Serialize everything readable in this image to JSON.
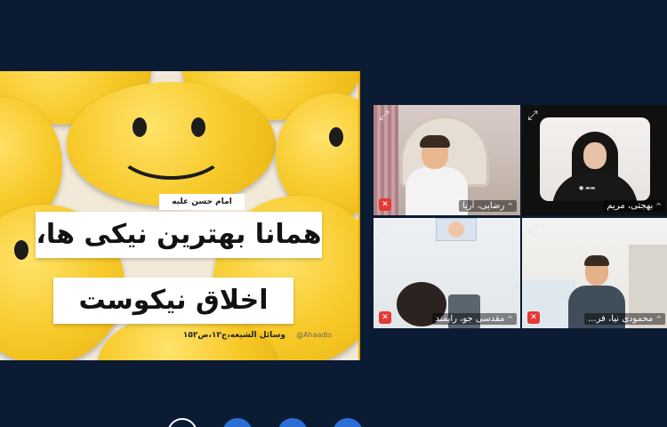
{
  "shared_content": {
    "attribution": "امام حسن علیه السلام",
    "line1": "همانا بهترین نیکی ها،",
    "line2": "اخلاق نیکوست",
    "source": "وسائل الشیعه،ج۱۲،ص۱۵۲",
    "handle": "@Ahaadis"
  },
  "participants": [
    {
      "name": "رضایی، آریا",
      "mic_icon": "mic-muted-icon",
      "expand_icon": "expand-icon"
    },
    {
      "name": "بهجتی، مریم",
      "mic_icon": "mic-on-icon",
      "expand_icon": "expand-icon"
    },
    {
      "name": "مقدسی جو، رایمند",
      "mic_icon": "mic-muted-icon",
      "expand_icon": "expand-icon"
    },
    {
      "name": "محمودی نیا، فر...",
      "mic_icon": "mic-muted-icon",
      "expand_icon": "expand-icon"
    }
  ],
  "colors": {
    "background": "#0b1b33",
    "mute_red": "#e53935",
    "toolbar_blue": "#2b6fd6",
    "smiley_yellow": "#f7c928"
  }
}
